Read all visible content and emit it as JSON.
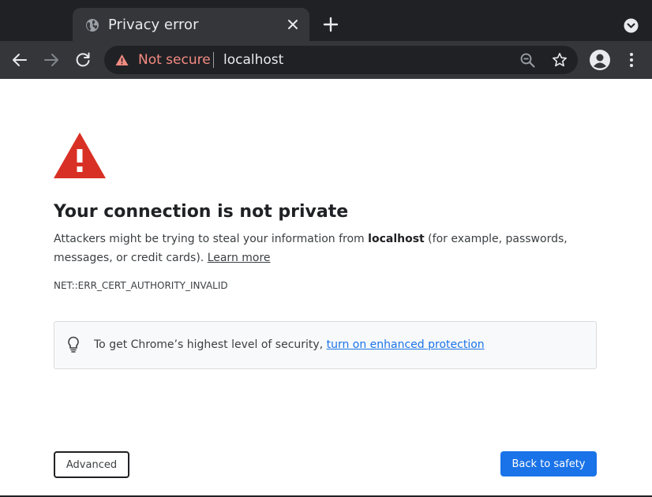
{
  "browser": {
    "tab": {
      "title": "Privacy error",
      "favicon": "globe-icon"
    },
    "toolbar": {
      "security_label": "Not secure",
      "url": "localhost",
      "security_color": "#f28b82"
    }
  },
  "page": {
    "heading": "Your connection is not private",
    "para_before": "Attackers might be trying to steal your information from ",
    "para_host": "localhost",
    "para_after": " (for example, passwords, messages, or credit cards). ",
    "learn_more": "Learn more",
    "error_code": "NET::ERR_CERT_AUTHORITY_INVALID",
    "info_text": "To get Chrome’s highest level of security, ",
    "info_link": "turn on enhanced protection",
    "advanced_button": "Advanced",
    "safety_button": "Back to safety"
  },
  "colors": {
    "chrome_dark": "#202124",
    "chrome_toolbar": "#35363a",
    "warning_red": "#d93025",
    "link_blue": "#1a73e8",
    "primary_button": "#1a73e8"
  }
}
